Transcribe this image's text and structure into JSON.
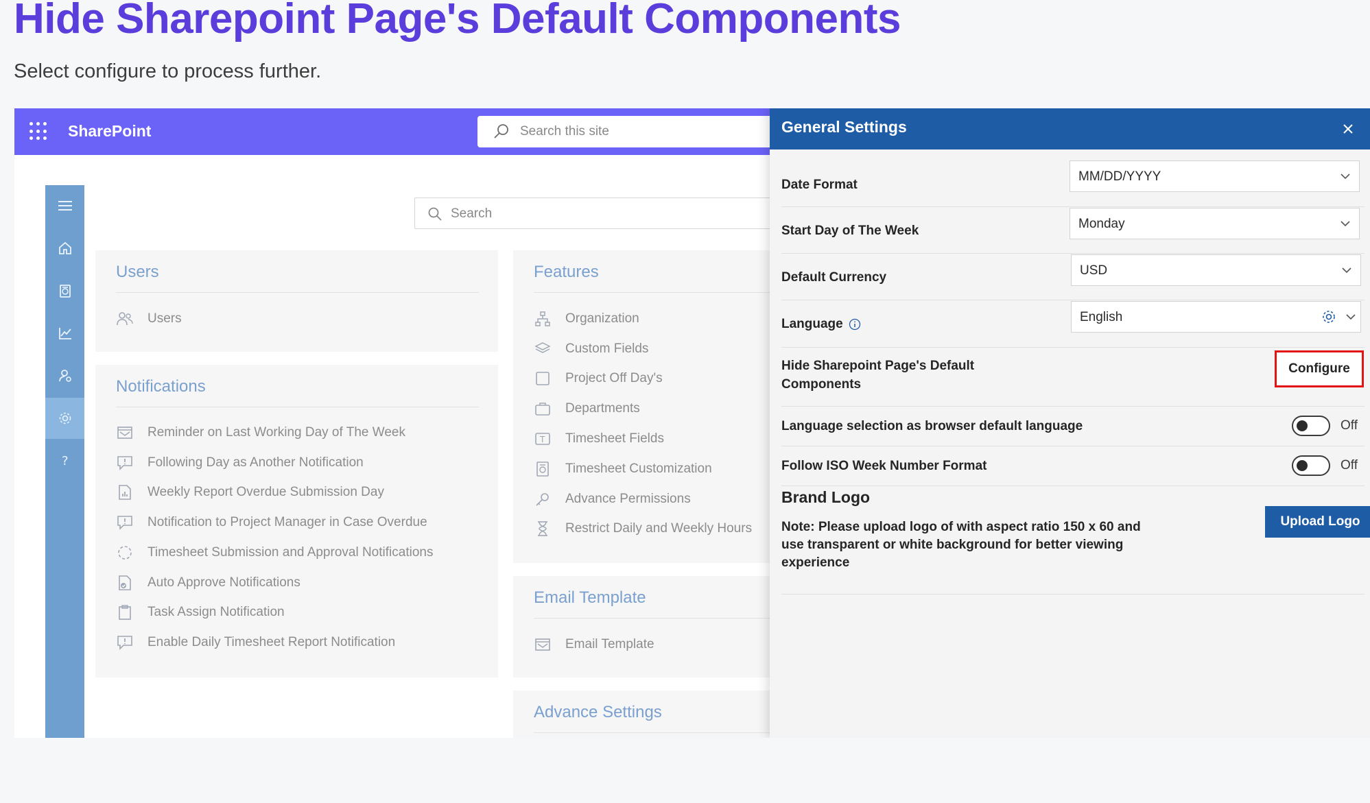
{
  "page": {
    "heading": "Hide Sharepoint Page's Default Components",
    "subheading": "Select configure to process further."
  },
  "suitebar": {
    "app_name": "SharePoint",
    "search_placeholder": "Search this site"
  },
  "content": {
    "search_placeholder": "Search",
    "rail_icons": [
      "menu-icon",
      "home-icon",
      "timesheet-icon",
      "chart-icon",
      "user-settings-icon",
      "gear-icon",
      "help-icon"
    ],
    "rail_active": "gear-icon",
    "users_card": {
      "title": "Users",
      "items": [
        {
          "label": "Users",
          "icon": "users-icon"
        }
      ]
    },
    "notifications_card": {
      "title": "Notifications",
      "items": [
        {
          "label": "Reminder on Last Working Day of The Week",
          "icon": "mail-calendar-icon"
        },
        {
          "label": "Following Day as Another Notification",
          "icon": "comment-alert-icon"
        },
        {
          "label": "Weekly Report Overdue Submission Day",
          "icon": "report-icon"
        },
        {
          "label": "Notification to Project Manager in Case Overdue",
          "icon": "comment-alert-icon"
        },
        {
          "label": "Timesheet Submission and Approval Notifications",
          "icon": "progress-ring-icon"
        },
        {
          "label": "Auto Approve Notifications",
          "icon": "document-check-icon"
        },
        {
          "label": "Task Assign Notification",
          "icon": "clipboard-icon"
        },
        {
          "label": "Enable Daily Timesheet Report Notification",
          "icon": "comment-alert-icon"
        }
      ]
    },
    "features_card": {
      "title": "Features",
      "items": [
        {
          "label": "Organization",
          "icon": "org-chart-icon"
        },
        {
          "label": "Custom Fields",
          "icon": "layers-icon"
        },
        {
          "label": "Project Off Day's",
          "icon": "checkbox-icon"
        },
        {
          "label": "Departments",
          "icon": "briefcase-icon"
        },
        {
          "label": "Timesheet Fields",
          "icon": "text-field-icon"
        },
        {
          "label": "Timesheet Customization",
          "icon": "timesheet-icon"
        },
        {
          "label": "Advance Permissions",
          "icon": "key-icon"
        },
        {
          "label": "Restrict Daily and Weekly Hours",
          "icon": "hourglass-icon"
        }
      ]
    },
    "email_card": {
      "title": "Email Template",
      "items": [
        {
          "label": "Email Template",
          "icon": "mail-calendar-icon"
        }
      ]
    },
    "advance_card": {
      "title": "Advance Settings"
    }
  },
  "panel": {
    "title": "General Settings",
    "date_format": {
      "label": "Date Format",
      "value": "MM/DD/YYYY"
    },
    "start_day": {
      "label": "Start Day of The Week",
      "value": "Monday"
    },
    "currency": {
      "label": "Default Currency",
      "value": "USD"
    },
    "language": {
      "label": "Language",
      "value": "English"
    },
    "hide_components": {
      "label": "Hide Sharepoint Page's Default Components",
      "button": "Configure"
    },
    "browser_language": {
      "label": "Language selection as browser default language",
      "state": "Off"
    },
    "iso_week": {
      "label": "Follow ISO Week Number Format",
      "state": "Off"
    },
    "brand_logo": {
      "title": "Brand Logo",
      "note": "Note: Please upload logo of with aspect ratio 150 x 60 and use transparent or white background for better viewing experience",
      "button": "Upload Logo"
    }
  },
  "colors": {
    "heading": "#5a3ddb",
    "suitebar": "#6b63f7",
    "panel_header": "#1f5ca6",
    "highlight_border": "#e31414"
  }
}
